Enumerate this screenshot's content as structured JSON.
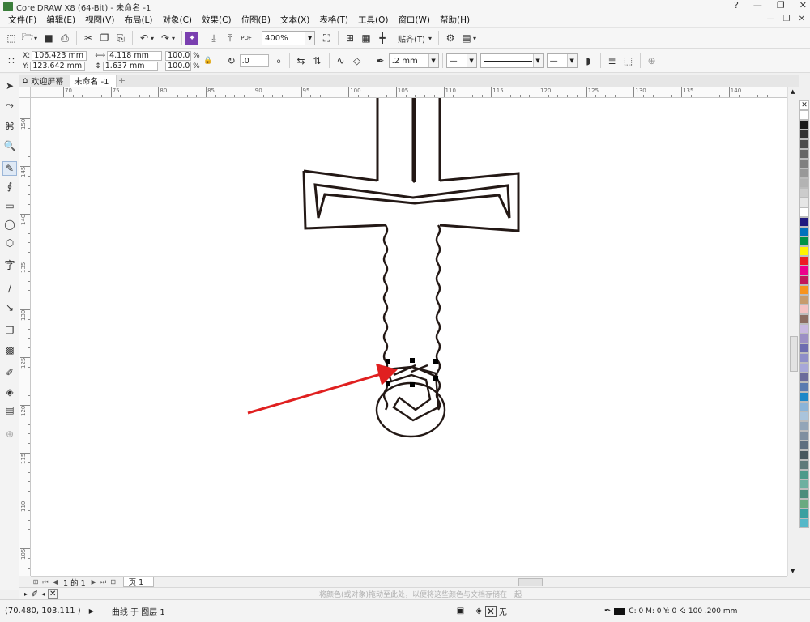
{
  "window": {
    "title": "CorelDRAW X8 (64-Bit) - 未命名 -1",
    "controls": [
      "?",
      "—",
      "❐",
      "✕"
    ]
  },
  "menu": {
    "items": [
      "文件(F)",
      "编辑(E)",
      "视图(V)",
      "布局(L)",
      "对象(C)",
      "效果(C)",
      "位图(B)",
      "文本(X)",
      "表格(T)",
      "工具(O)",
      "窗口(W)",
      "帮助(H)"
    ],
    "right": [
      "—",
      "❐",
      "✕"
    ]
  },
  "standard_toolbar": {
    "zoom": "400%",
    "snap": "贴齐(T)",
    "pdf_label": "PDF"
  },
  "property_bar": {
    "x": "106.423 mm",
    "y": "123.642 mm",
    "x_label": "X:",
    "y_label": "Y:",
    "width": "4.118 mm",
    "height": "1.637 mm",
    "scale_w": "100.0",
    "scale_h": "100.0",
    "pct1": "%",
    "pct2": "%",
    "rotation": ".0",
    "degree": "o",
    "outline_width": ".2 mm"
  },
  "tabs": {
    "welcome": "欢迎屏幕",
    "document": "未命名 -1",
    "add": "+"
  },
  "ruler": {
    "h_labels": [
      "70",
      "75",
      "80",
      "85",
      "90",
      "95",
      "100",
      "105",
      "110",
      "115",
      "120",
      "125",
      "130",
      "135",
      "140"
    ],
    "v_labels": [
      "150",
      "145",
      "140",
      "135",
      "130",
      "125",
      "120",
      "115",
      "110",
      "105"
    ],
    "unit_h": "毫米",
    "unit_v": "毫米"
  },
  "page_nav": {
    "page_count": "1 的 1",
    "page_tab": "页 1"
  },
  "hint": {
    "text": "将颜色(或对象)拖动至此处，以便将这些颜色与文档存储在一起"
  },
  "status": {
    "coords": "(70.480, 103.111 )",
    "object_info": "曲线 于 图层 1",
    "fill_none": "无",
    "outline_info": "C: 0 M: 0 Y: 0 K: 100  .200 mm"
  },
  "palette": {
    "colors": [
      "#ffffff",
      "#1a1a1a",
      "#333333",
      "#4d4d4d",
      "#666666",
      "#808080",
      "#999999",
      "#b3b3b3",
      "#cccccc",
      "#e6e6e6",
      "#ffffff",
      "#1f1a7f",
      "#0071bc",
      "#009245",
      "#fff200",
      "#ed1c24",
      "#ec008c",
      "#c2185b",
      "#f7941d",
      "#c69c6d",
      "#f4c2c2",
      "#8c6d62",
      "#c8b8e0",
      "#9b8fc4",
      "#6d6db0",
      "#8e8ec8",
      "#a7a7d8",
      "#6c6c9c",
      "#5a7bb0",
      "#1e88c8",
      "#8ab4d8",
      "#aac4dc",
      "#93a5b8",
      "#7f8fa0",
      "#5f6f80",
      "#48585f",
      "#5f7a7a",
      "#4d9a8a",
      "#6cb0a0",
      "#4c8c7c",
      "#6aaa80",
      "#3aa0a0",
      "#55b8c8"
    ]
  },
  "colors": {
    "accent": "#e02020",
    "outline": "#231815"
  }
}
